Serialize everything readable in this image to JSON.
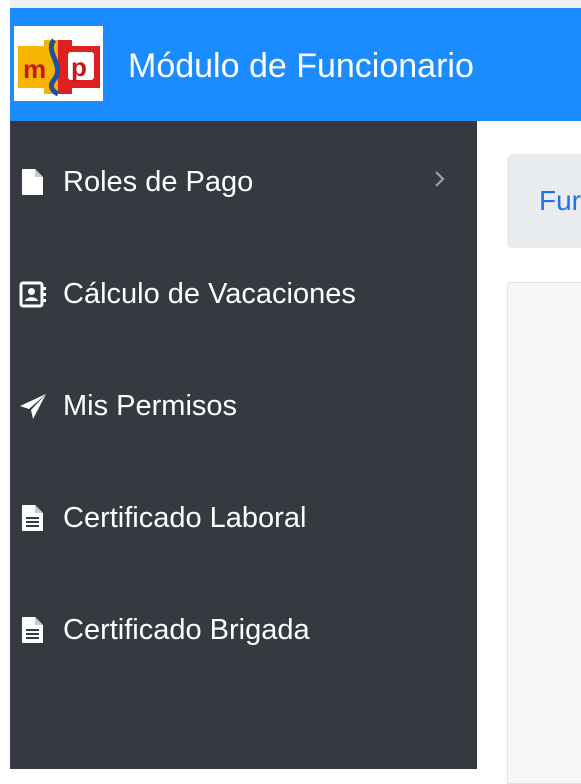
{
  "header": {
    "app_title": "Módulo de Funcionario",
    "logo_letters": "msp",
    "background": "#1a8cff"
  },
  "sidebar": {
    "background": "#343a40",
    "items": [
      {
        "label": "Roles de Pago",
        "icon": "file-icon",
        "has_submenu": true
      },
      {
        "label": "Cálculo de Vacaciones",
        "icon": "contact-card-icon",
        "has_submenu": false
      },
      {
        "label": "Mis Permisos",
        "icon": "paper-plane-icon",
        "has_submenu": false
      },
      {
        "label": "Certificado Laboral",
        "icon": "file-text-icon",
        "has_submenu": false
      },
      {
        "label": "Certificado Brigada",
        "icon": "file-text-icon",
        "has_submenu": false
      }
    ]
  },
  "main": {
    "breadcrumb_text": "Fur"
  }
}
